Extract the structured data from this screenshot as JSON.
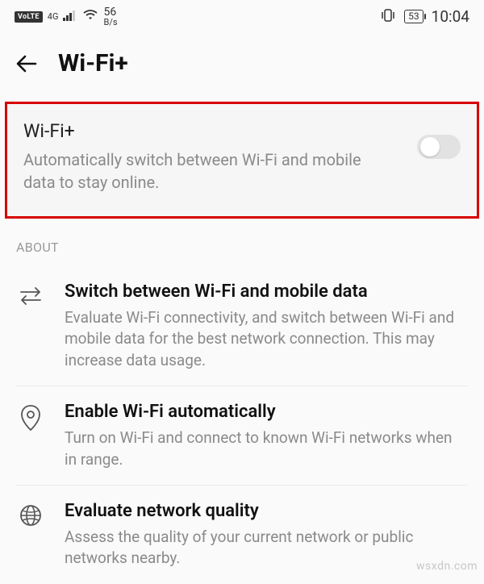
{
  "status_bar": {
    "volte": "VoLTE",
    "net_4g": "4G",
    "speed_num": "56",
    "speed_unit": "B/s",
    "battery": "53",
    "time": "10:04"
  },
  "header": {
    "title": "Wi-Fi+"
  },
  "card": {
    "title": "Wi-Fi+",
    "desc": "Automatically switch between Wi-Fi and mobile data to stay online."
  },
  "section_label": "ABOUT",
  "items": [
    {
      "title": "Switch between Wi-Fi and mobile data",
      "desc": "Evaluate Wi-Fi connectivity, and switch between Wi-Fi and mobile data for the best network connection. This may increase data usage."
    },
    {
      "title": "Enable Wi-Fi automatically",
      "desc": "Turn on Wi-Fi and connect to known Wi-Fi networks when in range."
    },
    {
      "title": "Evaluate network quality",
      "desc": "Assess the quality of your current network or public networks nearby."
    }
  ],
  "watermark": "wsxdn.com"
}
